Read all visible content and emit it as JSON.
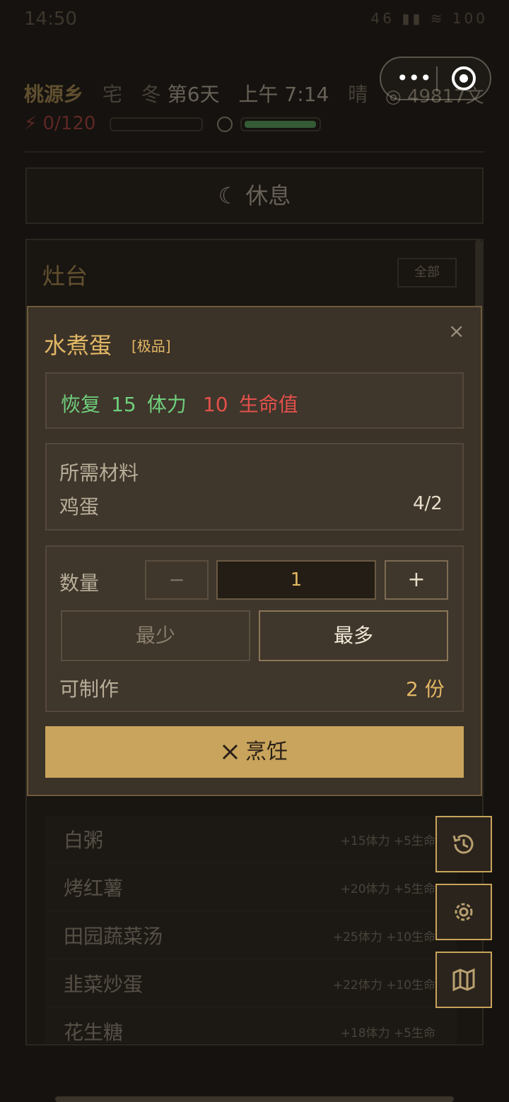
{
  "status_bar": {
    "time": "14:50",
    "icons": "46 ▮▮ ≋ 100"
  },
  "capsule": {
    "dots": "•••"
  },
  "header": {
    "village": "桃源乡",
    "home": "宅",
    "season": "冬",
    "day": "第6天",
    "clock": "上午 7:14",
    "weather": "晴",
    "money": "◎ 49817文",
    "stamina": "⚡ 0/120"
  },
  "rest_button": {
    "label": "☾ 休息"
  },
  "stove": {
    "title": "灶台",
    "filter_label": "全部",
    "recipes": [
      {
        "name": "白粥",
        "effect": "+15体力 +5生命"
      },
      {
        "name": "烤红薯",
        "effect": "+20体力 +5生命"
      },
      {
        "name": "田园蔬菜汤",
        "effect": "+25体力 +10生命"
      },
      {
        "name": "韭菜炒蛋",
        "effect": "+22体力 +10生命"
      },
      {
        "name": "花生糖",
        "effect": "+18体力 +5生命"
      }
    ]
  },
  "modal": {
    "title": "水煮蛋",
    "badge": "[极品]",
    "close": "×",
    "effect": {
      "restore": "恢复",
      "stamina_value": "15",
      "stamina_label": "体力",
      "hp_value": "10",
      "hp_label": "生命值"
    },
    "materials": {
      "title": "所需材料",
      "item": "鸡蛋",
      "count": "4/2"
    },
    "quantity": {
      "label": "数量",
      "minus": "−",
      "value": "1",
      "plus": "+",
      "min_label": "最少",
      "max_label": "最多"
    },
    "craftable": {
      "label": "可制作",
      "value": "2 份"
    },
    "cook_button": {
      "label": "烹饪"
    }
  },
  "fabs": {
    "history": "history-icon",
    "settings": "gear-icon",
    "map": "map-icon"
  },
  "colors": {
    "accent": "#c8a45c",
    "green": "#6fcf7c",
    "red": "#e3514b",
    "background": "#15120f"
  }
}
